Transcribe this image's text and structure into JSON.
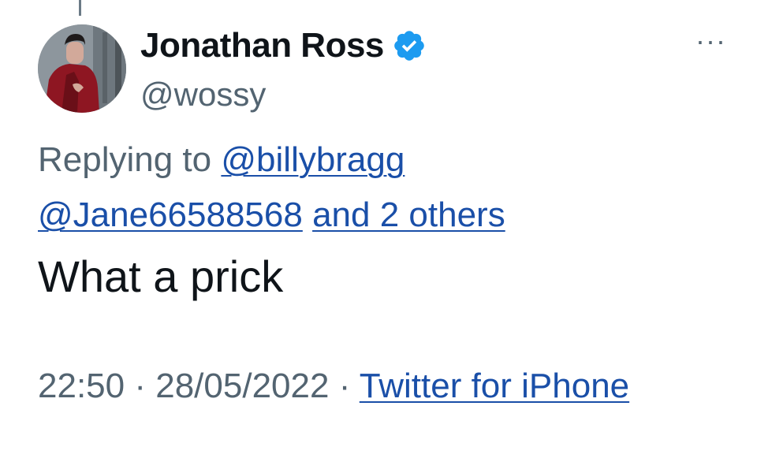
{
  "tweet": {
    "author": {
      "display_name": "Jonathan Ross",
      "handle": "@wossy",
      "verified": true,
      "verified_icon": "verified-badge-icon",
      "avatar": "profile-photo"
    },
    "more_label": "···",
    "reply_context": {
      "prefix": "Replying to",
      "mentions": [
        "@billybragg",
        "@Jane66588568"
      ],
      "others": "and 2 others"
    },
    "text": "What a prick",
    "meta": {
      "time": "22:50",
      "separator": "·",
      "date": "28/05/2022",
      "source": "Twitter for iPhone"
    }
  },
  "colors": {
    "link": "#1a4fa8",
    "secondary_text": "#536471",
    "verified_badge": "#1d9bf0"
  }
}
